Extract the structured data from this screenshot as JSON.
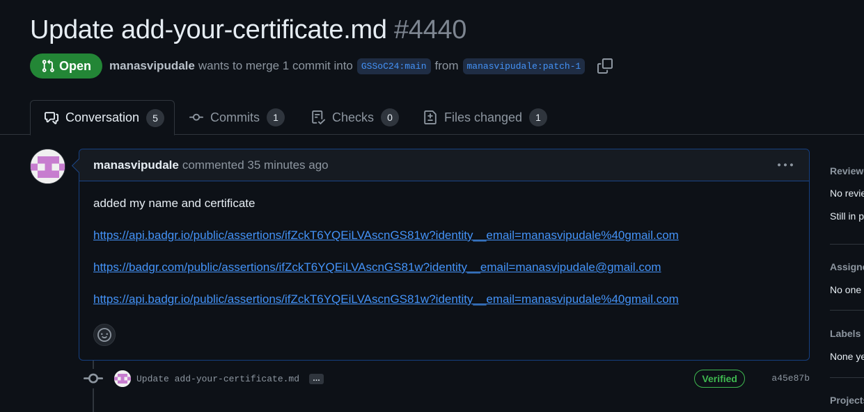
{
  "pr": {
    "title": "Update add-your-certificate.md",
    "number": "#4440",
    "state": "Open",
    "author": "manasvipudale",
    "merge_text": "wants to merge 1 commit into",
    "base_branch": "GSSoC24:main",
    "from_text": "from",
    "head_branch": "manasvipudale:patch-1"
  },
  "tabs": [
    {
      "label": "Conversation",
      "count": "5",
      "icon": "comment-discussion-icon"
    },
    {
      "label": "Commits",
      "count": "1",
      "icon": "git-commit-icon"
    },
    {
      "label": "Checks",
      "count": "0",
      "icon": "checklist-icon"
    },
    {
      "label": "Files changed",
      "count": "1",
      "icon": "file-diff-icon"
    }
  ],
  "comment": {
    "author": "manasvipudale",
    "meta": "commented 35 minutes ago",
    "body_text": "added my name and certificate",
    "links": [
      "https://api.badgr.io/public/assertions/ifZckT6YQEiLVAscnGS81w?identity__email=manasvipudale%40gmail.com",
      "https://badgr.com/public/assertions/ifZckT6YQEiLVAscnGS81w?identity__email=manasvipudale@gmail.com",
      "https://api.badgr.io/public/assertions/ifZckT6YQEiLVAscnGS81w?identity__email=manasvipudale%40gmail.com"
    ]
  },
  "commit": {
    "message": "Update add-your-certificate.md",
    "ellipsis": "…",
    "badge": "Verified",
    "sha": "a45e87b"
  },
  "sidebar": {
    "reviewers_head": "Reviewers",
    "reviewers_val1": "No reviews",
    "reviewers_val2": "Still in progress?",
    "assignees_head": "Assignees",
    "assignees_val": "No one assigned",
    "labels_head": "Labels",
    "labels_val": "None yet",
    "projects_head": "Projects"
  },
  "colors": {
    "open_green": "#238636",
    "link_blue": "#4493f8",
    "verified_green": "#3fb950"
  }
}
